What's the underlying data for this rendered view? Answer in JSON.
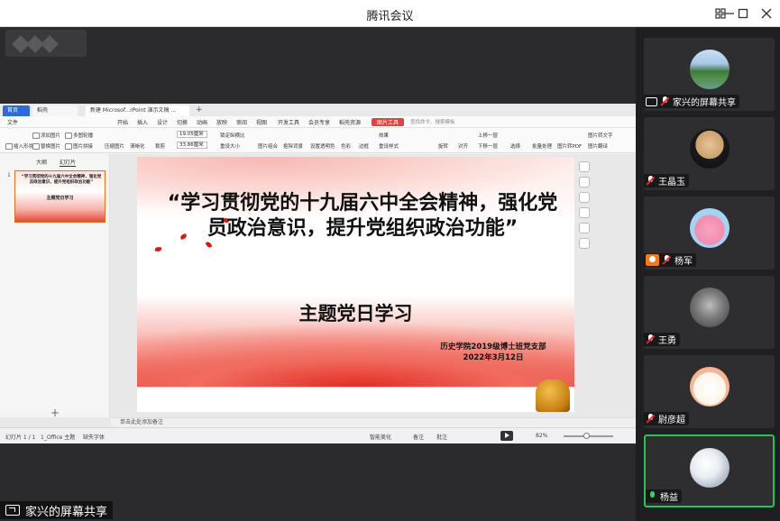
{
  "window": {
    "title": "腾讯会议"
  },
  "window_controls": [
    "grid-icon",
    "minimize-icon",
    "maximize-icon",
    "close-icon"
  ],
  "share_banner": {
    "label": "家兴的屏幕共享"
  },
  "wps": {
    "tabs": {
      "home": "首页",
      "find": "稻壳",
      "doc": "新建 Microsof...rPoint 演示文稿 ..."
    },
    "menu": [
      "文件",
      "开始",
      "插入",
      "设计",
      "切换",
      "动画",
      "放映",
      "审阅",
      "视图",
      "开发工具",
      "会员专享",
      "稻壳资源",
      "图片工具"
    ],
    "search_placeholder": "查找命令、搜索模板",
    "ribbon": {
      "insert_shape": "插入形状",
      "add_image": "添加图片",
      "replace_image": "替换图片",
      "multi_image": "多图轮播",
      "image_split": "图片拼接",
      "compress": "压缩图片",
      "clear": "清晰化",
      "crop": "裁剪",
      "width": "19.05厘米",
      "height": "33.86厘米",
      "lock_ratio": "锁定纵横比",
      "reset_size": "重设大小",
      "image_group": "图片组合",
      "cutout_bg": "抠除背景",
      "set_transparent": "设置透明色",
      "color": "色彩",
      "border": "边框",
      "effect": "效果",
      "reset_style": "重设样式",
      "rotate": "旋转",
      "align": "对齐",
      "combine": "组合",
      "up_layer": "上移一层",
      "down_layer": "下移一层",
      "select": "选择",
      "batch": "批量处理",
      "to_pdf": "图片转PDF",
      "to_text": "图片转文字",
      "translate": "图片翻译"
    },
    "pane_tabs": [
      "大纲",
      "幻灯片"
    ],
    "thumb_number": "1",
    "thumb_title": "“学习贯彻党的十九届六中全会精神，强化党员政治意识，提升党组织政治功能”",
    "thumb_sub": "主题党日学习",
    "notes_placeholder": "单击此处添加备注",
    "status": {
      "slide_info": "幻灯片 1 / 1",
      "theme": "1_Office 主题",
      "font_missing": "缺失字体",
      "smart_beautify": "智能美化",
      "notes": "备注",
      "comment": "批注",
      "zoom": "82%"
    }
  },
  "slide": {
    "title": "“学习贯彻党的十九届六中全会精神，强化党员政治意识，提升党组织政治功能”",
    "subtitle": "主题党日学习",
    "org": "历史学院2019级博士班党支部",
    "date": "2022年3月12日"
  },
  "participants": [
    {
      "name": "家兴的屏幕共享",
      "avatar": "lake-landscape",
      "badge": "screen-share",
      "mic": "muted"
    },
    {
      "name": "王晶玉",
      "avatar": "plush-dog",
      "badge": "",
      "mic": "muted"
    },
    {
      "name": "杨军",
      "avatar": "peppa-pig",
      "badge": "host",
      "mic": "muted"
    },
    {
      "name": "王勇",
      "avatar": "bw-photo",
      "badge": "",
      "mic": "muted"
    },
    {
      "name": "尉彦超",
      "avatar": "cartoon-bunny",
      "badge": "",
      "mic": "muted"
    },
    {
      "name": "杨益",
      "avatar": "white-flowers",
      "badge": "",
      "mic": "active"
    }
  ],
  "colors": {
    "accent_green": "#2fbf5a",
    "wps_blue": "#2f6bd8",
    "slide_red": "#e32d24"
  }
}
